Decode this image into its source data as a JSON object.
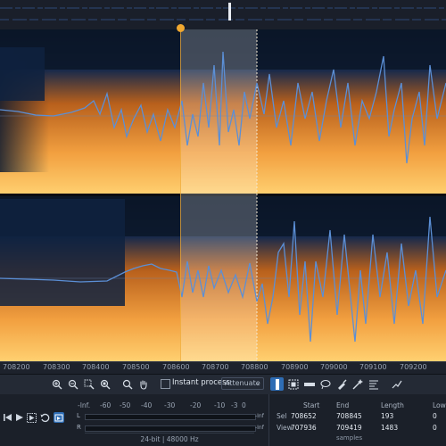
{
  "ruler": {
    "ticks": [
      "708200",
      "708300",
      "708400",
      "708500",
      "708600",
      "708700",
      "708800",
      "708900",
      "709000",
      "709100",
      "709200"
    ]
  },
  "toolbar": {
    "instant_process_label": "Instant process",
    "mode_value": "Attenuate",
    "mode_arrow": "⌄"
  },
  "meter": {
    "scale": [
      "-Inf.",
      "-60",
      "-50",
      "-40",
      "-30",
      "-20",
      "-10",
      "-3",
      "0"
    ],
    "left_label": "L",
    "right_label": "R",
    "reset_label": "-Inf",
    "format": "24-bit | 48000 Hz"
  },
  "selection": {
    "headers": [
      "Start",
      "End",
      "Length",
      "Low"
    ],
    "sel_label": "Sel",
    "view_label": "View",
    "sel": {
      "start": "708652",
      "end": "708845",
      "length": "193",
      "low": "0"
    },
    "view": {
      "start": "707936",
      "end": "709419",
      "length": "1483",
      "low": "0"
    },
    "unit": "samples"
  },
  "colors": {
    "background": "#141820",
    "accent": "#2e6db5",
    "playhead": "#f0a830",
    "waveform": "#5b8fd6"
  }
}
